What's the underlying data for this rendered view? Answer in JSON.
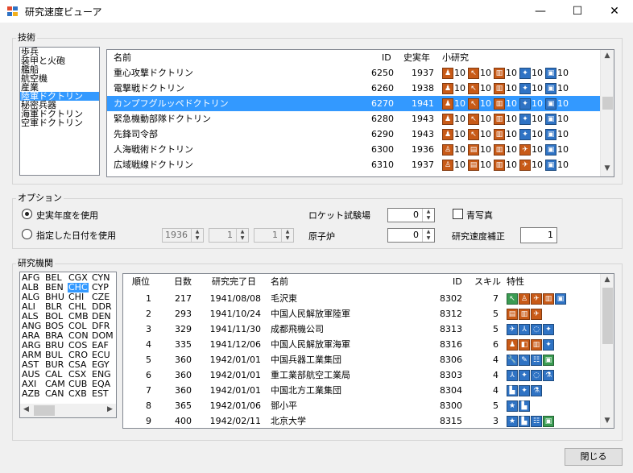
{
  "window": {
    "title": "研究速度ビューア",
    "minimize": "—",
    "maximize": "☐",
    "close": "✕"
  },
  "tech": {
    "group_label": "技術",
    "categories": [
      "歩兵",
      "装甲と火砲",
      "艦船",
      "航空機",
      "産業",
      "陸軍ドクトリン",
      "秘密兵器",
      "海軍ドクトリン",
      "空軍ドクトリン"
    ],
    "selected_index": 5,
    "columns": {
      "name": "名前",
      "id": "ID",
      "year": "史実年",
      "sub": "小研究"
    },
    "rows": [
      {
        "name": "重心攻撃ドクトリン",
        "id": "6250",
        "year": "1937",
        "icons": [
          [
            "o",
            "♟"
          ],
          [
            "o",
            "↖"
          ],
          [
            "o",
            "▥"
          ],
          [
            "b",
            "✦"
          ],
          [
            "b",
            "▣"
          ]
        ],
        "vals": [
          "10",
          "10",
          "10",
          "10",
          "10"
        ]
      },
      {
        "name": "電撃戦ドクトリン",
        "id": "6260",
        "year": "1938",
        "icons": [
          [
            "o",
            "♟"
          ],
          [
            "o",
            "↖"
          ],
          [
            "o",
            "▥"
          ],
          [
            "b",
            "✦"
          ],
          [
            "b",
            "▣"
          ]
        ],
        "vals": [
          "10",
          "10",
          "10",
          "10",
          "10"
        ]
      },
      {
        "name": "カンプフグルッペドクトリン",
        "id": "6270",
        "year": "1941",
        "icons": [
          [
            "o",
            "♟"
          ],
          [
            "o",
            "↖"
          ],
          [
            "o",
            "▥"
          ],
          [
            "b",
            "✦"
          ],
          [
            "b",
            "▣"
          ]
        ],
        "vals": [
          "10",
          "10",
          "10",
          "10",
          "10"
        ]
      },
      {
        "name": "緊急機動部隊ドクトリン",
        "id": "6280",
        "year": "1943",
        "icons": [
          [
            "o",
            "♟"
          ],
          [
            "o",
            "↖"
          ],
          [
            "o",
            "▥"
          ],
          [
            "b",
            "✦"
          ],
          [
            "b",
            "▣"
          ]
        ],
        "vals": [
          "10",
          "10",
          "10",
          "10",
          "10"
        ]
      },
      {
        "name": "先鋒司令部",
        "id": "6290",
        "year": "1943",
        "icons": [
          [
            "o",
            "♟"
          ],
          [
            "o",
            "↖"
          ],
          [
            "o",
            "▥"
          ],
          [
            "b",
            "✦"
          ],
          [
            "b",
            "▣"
          ]
        ],
        "vals": [
          "10",
          "10",
          "10",
          "10",
          "10"
        ]
      },
      {
        "name": "人海戦術ドクトリン",
        "id": "6300",
        "year": "1936",
        "icons": [
          [
            "o",
            "♙"
          ],
          [
            "o",
            "▤"
          ],
          [
            "o",
            "▥"
          ],
          [
            "o",
            "✈"
          ],
          [
            "b",
            "▣"
          ]
        ],
        "vals": [
          "10",
          "10",
          "10",
          "10",
          "10"
        ]
      },
      {
        "name": "広域戦線ドクトリン",
        "id": "6310",
        "year": "1937",
        "icons": [
          [
            "o",
            "♙"
          ],
          [
            "o",
            "▤"
          ],
          [
            "o",
            "▥"
          ],
          [
            "o",
            "✈"
          ],
          [
            "b",
            "▣"
          ]
        ],
        "vals": [
          "10",
          "10",
          "10",
          "10",
          "10"
        ]
      }
    ]
  },
  "options": {
    "group_label": "オプション",
    "radio_historical": "史実年度を使用",
    "radio_date": "指定した日付を使用",
    "date_year": "1936",
    "date_month": "1",
    "date_day": "1",
    "rocket_label": "ロケット試験場",
    "rocket_value": "0",
    "reactor_label": "原子炉",
    "reactor_value": "0",
    "blueprint_label": "青写真",
    "modifier_label": "研究速度補正",
    "modifier_value": "1",
    "spin_up": "▲",
    "spin_down": "▼"
  },
  "institutes": {
    "group_label": "研究機関",
    "countries": [
      [
        "AFG",
        "BEL",
        "CGX",
        "CYN"
      ],
      [
        "ALB",
        "BEN",
        "CHC",
        "CYP"
      ],
      [
        "ALG",
        "BHU",
        "CHI",
        "CZE"
      ],
      [
        "ALI",
        "BLR",
        "CHL",
        "DDR"
      ],
      [
        "ALS",
        "BOL",
        "CMB",
        "DEN"
      ],
      [
        "ANG",
        "BOS",
        "COL",
        "DFR"
      ],
      [
        "ARA",
        "BRA",
        "CON",
        "DOM"
      ],
      [
        "ARG",
        "BRU",
        "COS",
        "EAF"
      ],
      [
        "ARM",
        "BUL",
        "CRO",
        "ECU"
      ],
      [
        "AST",
        "BUR",
        "CSA",
        "EGY"
      ],
      [
        "AUS",
        "CAL",
        "CSX",
        "ENG"
      ],
      [
        "AXI",
        "CAM",
        "CUB",
        "EQA"
      ],
      [
        "AZB",
        "CAN",
        "CXB",
        "EST"
      ]
    ],
    "selected_country": "CHC",
    "columns": {
      "rank": "順位",
      "days": "日数",
      "done": "研究完了日",
      "name": "名前",
      "id": "ID",
      "skill": "スキル",
      "traits": "特性"
    },
    "rows": [
      {
        "rank": "1",
        "days": "217",
        "done": "1941/08/08",
        "name": "毛沢東",
        "id": "8302",
        "skill": "7",
        "icons": [
          [
            "g",
            "↖"
          ],
          [
            "o",
            "♙"
          ],
          [
            "o",
            "✈"
          ],
          [
            "o",
            "▥"
          ],
          [
            "b",
            "▣"
          ]
        ]
      },
      {
        "rank": "2",
        "days": "293",
        "done": "1941/10/24",
        "name": "中国人民解放軍陸軍",
        "id": "8312",
        "skill": "5",
        "icons": [
          [
            "o",
            "▤"
          ],
          [
            "o",
            "▥"
          ],
          [
            "o",
            "✈"
          ]
        ]
      },
      {
        "rank": "3",
        "days": "329",
        "done": "1941/11/30",
        "name": "成都飛機公司",
        "id": "8313",
        "skill": "5",
        "icons": [
          [
            "b",
            "✈"
          ],
          [
            "b",
            "⅄"
          ],
          [
            "b",
            "◌"
          ],
          [
            "b",
            "✦"
          ]
        ]
      },
      {
        "rank": "4",
        "days": "335",
        "done": "1941/12/06",
        "name": "中国人民解放軍海軍",
        "id": "8316",
        "skill": "6",
        "icons": [
          [
            "o",
            "♟"
          ],
          [
            "o",
            "◧"
          ],
          [
            "o",
            "▥"
          ],
          [
            "b",
            "✦"
          ]
        ]
      },
      {
        "rank": "5",
        "days": "360",
        "done": "1942/01/01",
        "name": "中国兵器工業集団",
        "id": "8306",
        "skill": "4",
        "icons": [
          [
            "b",
            "🔧"
          ],
          [
            "b",
            "✎"
          ],
          [
            "b",
            "☷"
          ],
          [
            "g",
            "▣"
          ]
        ]
      },
      {
        "rank": "6",
        "days": "360",
        "done": "1942/01/01",
        "name": "重工業部航空工業局",
        "id": "8303",
        "skill": "4",
        "icons": [
          [
            "b",
            "⅄"
          ],
          [
            "b",
            "✦"
          ],
          [
            "b",
            "◌"
          ],
          [
            "b",
            "⚗"
          ]
        ]
      },
      {
        "rank": "7",
        "days": "360",
        "done": "1942/01/01",
        "name": "中国北方工業集団",
        "id": "8304",
        "skill": "4",
        "icons": [
          [
            "b",
            "▙"
          ],
          [
            "b",
            "✦"
          ],
          [
            "b",
            "⚗"
          ]
        ]
      },
      {
        "rank": "8",
        "days": "365",
        "done": "1942/01/06",
        "name": "鄧小平",
        "id": "8300",
        "skill": "5",
        "icons": [
          [
            "b",
            "★"
          ],
          [
            "b",
            "▙"
          ]
        ]
      },
      {
        "rank": "9",
        "days": "400",
        "done": "1942/02/11",
        "name": "北京大学",
        "id": "8315",
        "skill": "3",
        "icons": [
          [
            "b",
            "★"
          ],
          [
            "b",
            "▙"
          ],
          [
            "b",
            "☷"
          ],
          [
            "g",
            "▣"
          ]
        ]
      }
    ]
  },
  "close_button": "閉じる",
  "scroll": {
    "up": "▲",
    "down": "▼",
    "left": "◀",
    "right": "▶"
  }
}
